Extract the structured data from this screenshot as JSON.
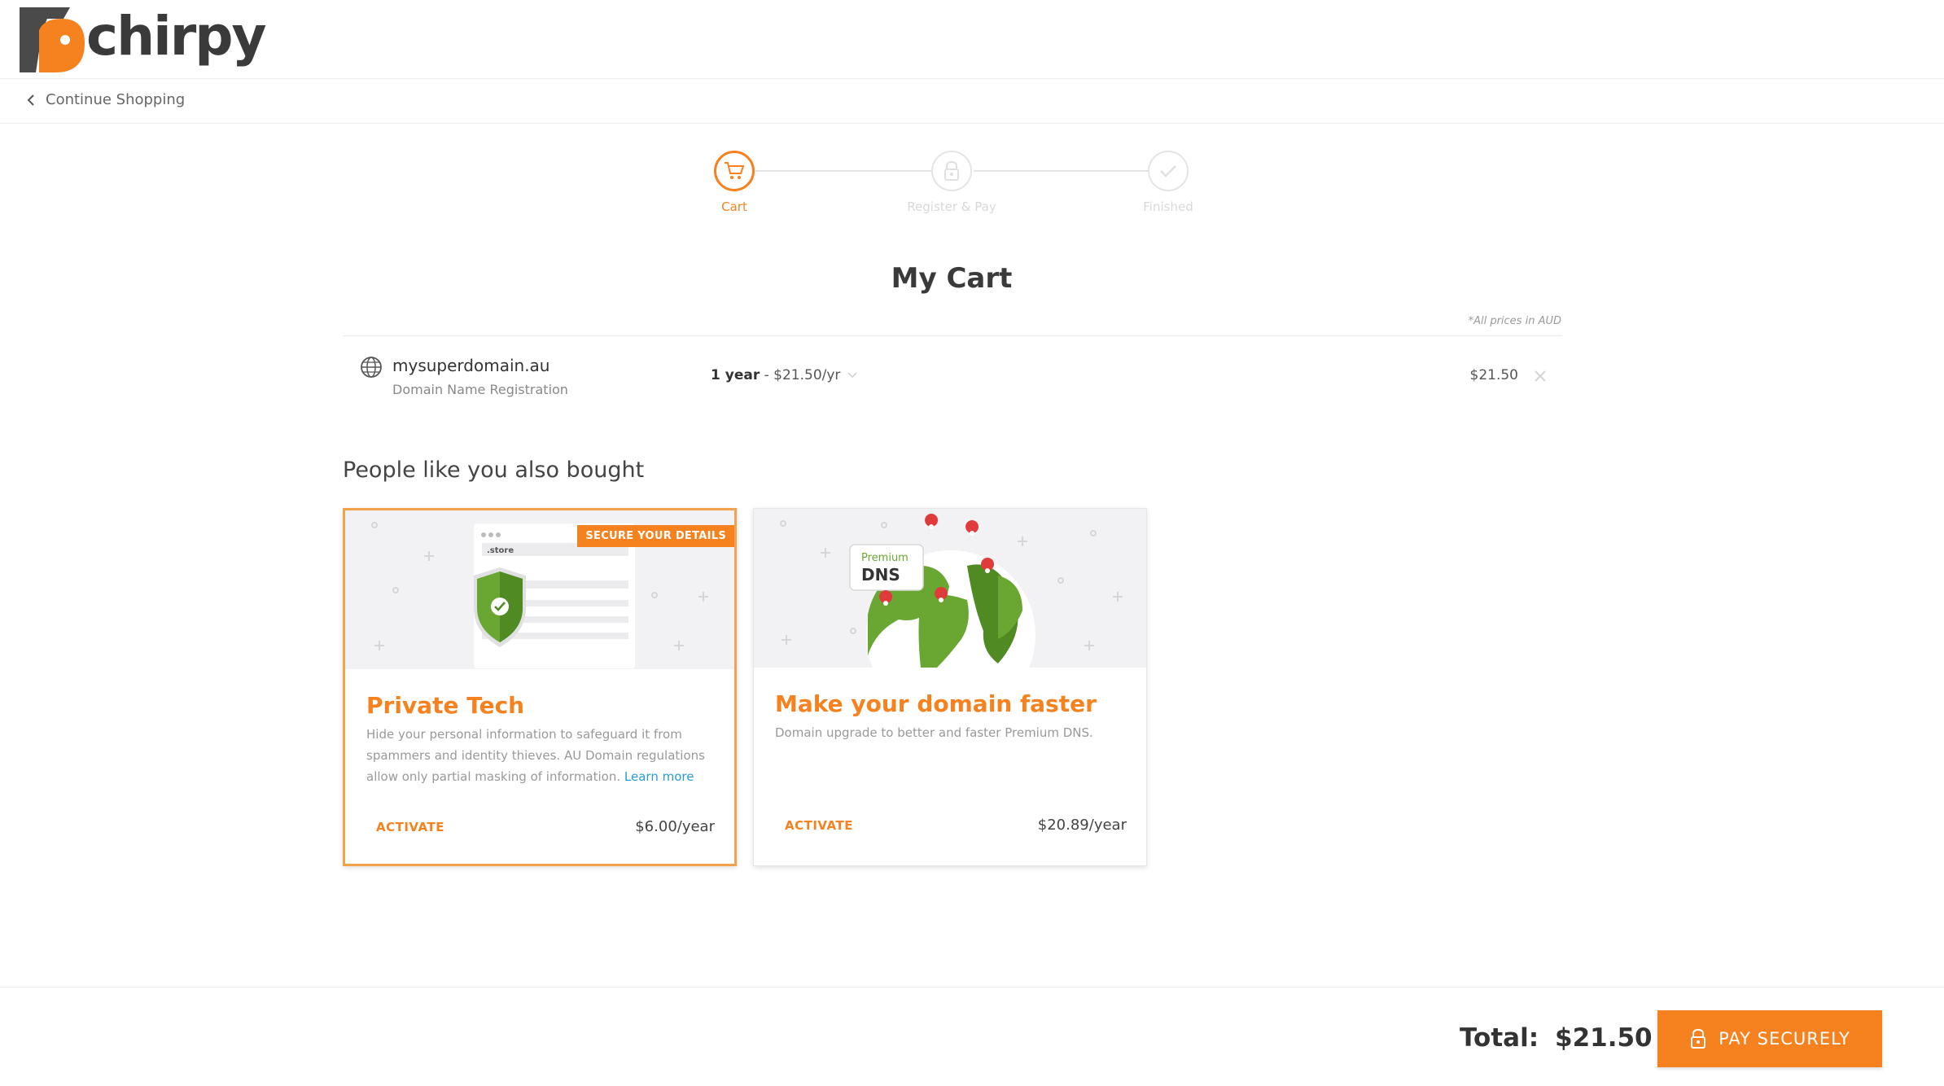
{
  "brand": {
    "name": "chirpy",
    "accent_color": "#f5821f",
    "logo_dark": "#3a3a3a"
  },
  "nav": {
    "continue_label": "Continue Shopping",
    "back_icon": "chevron-left-icon"
  },
  "stepper": {
    "steps": [
      {
        "label": "Cart",
        "icon": "cart-icon",
        "active": true
      },
      {
        "label": "Register & Pay",
        "icon": "lock-icon",
        "active": false
      },
      {
        "label": "Finished",
        "icon": "check-icon",
        "active": false
      }
    ]
  },
  "cart": {
    "title": "My Cart",
    "price_note": "*All prices in AUD",
    "items": [
      {
        "icon": "globe-icon",
        "name": "mysuperdomain.au",
        "subtitle": "Domain Name Registration",
        "term_bold": "1 year",
        "term_rest": "- $21.50/yr",
        "price": "$21.50"
      }
    ]
  },
  "upsell": {
    "heading": "People like you also bought",
    "cards": [
      {
        "badge": "SECURE YOUR DETAILS",
        "image_label": ".store",
        "title": "Private Tech",
        "description": "Hide your personal information to safeguard it from spammers and identity thieves. AU Domain regulations allow only partial masking of information.",
        "link_label": "Learn more",
        "action": "ACTIVATE",
        "price": "$6.00/year",
        "selected": true
      },
      {
        "image_label_small": "Premium",
        "image_label_big": "DNS",
        "title": "Make your domain faster",
        "description": "Domain upgrade to better and faster Premium DNS.",
        "action": "ACTIVATE",
        "price": "$20.89/year",
        "selected": false
      }
    ]
  },
  "footer": {
    "total_label": "Total:",
    "total_value": "$21.50",
    "pay_label": "PAY SECURELY"
  }
}
